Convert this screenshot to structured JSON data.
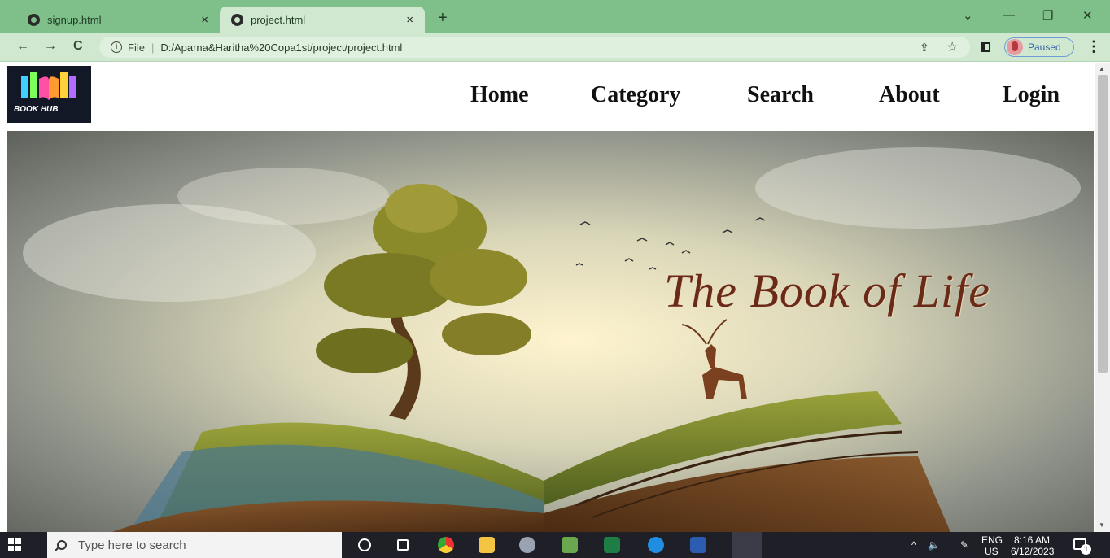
{
  "browser": {
    "tabs": [
      {
        "title": "signup.html",
        "close": "×"
      },
      {
        "title": "project.html",
        "close": "×"
      }
    ],
    "new_tab": "+",
    "window_controls": {
      "dropdown": "⌄",
      "minimize": "—",
      "restore": "❐",
      "close": "✕"
    },
    "nav": {
      "back": "←",
      "forward": "→",
      "reload": "C"
    },
    "address": {
      "info": "i",
      "scheme_label": "File",
      "separator": "|",
      "url": "D:/Aparna&Haritha%20Copa1st/project/project.html"
    },
    "share_icon": "⇪",
    "star_icon": "☆",
    "profile_status": "Paused",
    "menu_icon": "⋮"
  },
  "site": {
    "logo_text": "BOOK HUB",
    "nav": [
      "Home",
      "Category",
      "Search",
      "About",
      "Login"
    ],
    "hero_title": "The Book of Life"
  },
  "taskbar": {
    "search_placeholder": "Type here to search",
    "tray": {
      "chevron": "^",
      "volume": "🔈",
      "pen": "✎",
      "lang_top": "ENG",
      "lang_bottom": "US",
      "time": "8:16 AM",
      "date": "6/12/2023",
      "notif_count": "1"
    }
  },
  "colors": {
    "tab_strip": "#7fbf8a",
    "toolbar": "#cfe8cf",
    "taskbar": "#1f1f28",
    "hero_title": "#6b2a17"
  }
}
